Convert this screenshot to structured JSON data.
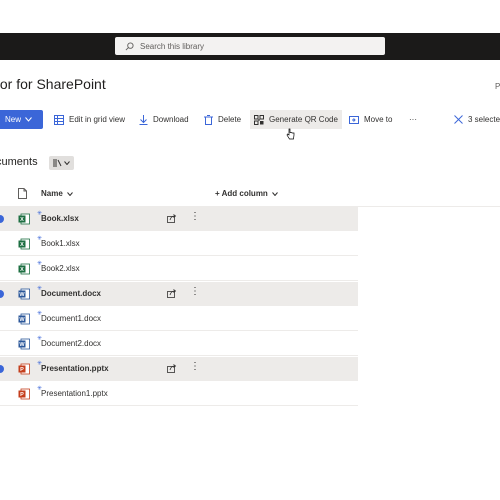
{
  "search": {
    "placeholder": "Search this library"
  },
  "site": {
    "title": "tor for SharePoint",
    "right_letter": "P"
  },
  "commandbar": {
    "new_label": "New",
    "edit_grid_label": "Edit in grid view",
    "download_label": "Download",
    "delete_label": "Delete",
    "generate_qr_label": "Generate QR Code",
    "move_to_label": "Move to",
    "more_label": "···",
    "selected_label": "3 selecte"
  },
  "library": {
    "title": "cuments"
  },
  "columns": {
    "name": "Name",
    "add_column": "+ Add column"
  },
  "files": [
    {
      "name": "Book.xlsx",
      "type": "xlsx",
      "selected": true
    },
    {
      "name": "Book1.xlsx",
      "type": "xlsx",
      "selected": false
    },
    {
      "name": "Book2.xlsx",
      "type": "xlsx",
      "selected": false
    },
    {
      "name": "Document.docx",
      "type": "docx",
      "selected": true
    },
    {
      "name": "Document1.docx",
      "type": "docx",
      "selected": false
    },
    {
      "name": "Document2.docx",
      "type": "docx",
      "selected": false
    },
    {
      "name": "Presentation.pptx",
      "type": "pptx",
      "selected": true
    },
    {
      "name": "Presentation1.pptx",
      "type": "pptx",
      "selected": false
    }
  ],
  "colors": {
    "accent": "#3b66d8",
    "topbar": "#1b1a19",
    "xlsx": "#1d6f42",
    "docx": "#2b579a",
    "pptx": "#c43e1c"
  }
}
